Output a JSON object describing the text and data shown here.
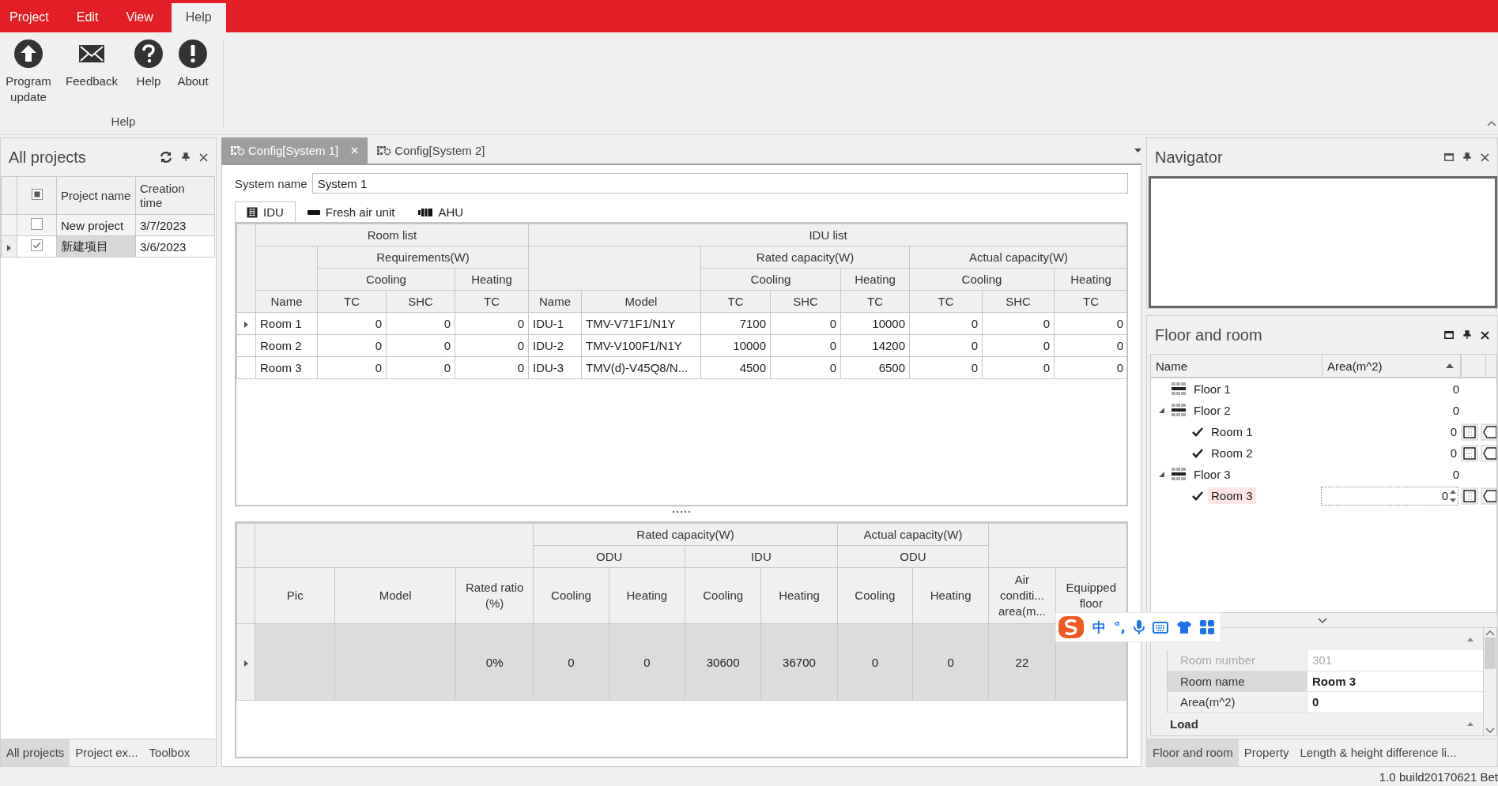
{
  "menu": [
    {
      "label": "Project",
      "selected": false
    },
    {
      "label": "Edit",
      "selected": false
    },
    {
      "label": "View",
      "selected": false
    },
    {
      "label": "Help",
      "selected": true
    }
  ],
  "ribbon": {
    "buttons": [
      "Program update",
      "Feedback",
      "Help",
      "About"
    ],
    "group_label": "Help"
  },
  "projects_panel": {
    "title": "All projects",
    "select_all": {
      "checked": false,
      "partial": true
    },
    "columns": [
      "Project name",
      "Creation time"
    ],
    "rows": [
      {
        "name": "New project",
        "date": "3/7/2023",
        "checked": false,
        "current": false
      },
      {
        "name": "新建项目",
        "date": "3/6/2023",
        "checked": true,
        "current": true
      }
    ],
    "tabs": [
      {
        "label": "All projects",
        "selected": true
      },
      {
        "label": "Project ex...",
        "selected": false
      },
      {
        "label": "Toolbox",
        "selected": false
      }
    ]
  },
  "doc_tabs": [
    {
      "label": "Config[System 1]",
      "selected": true
    },
    {
      "label": "Config[System 2]",
      "selected": false
    }
  ],
  "system_name": {
    "label": "System name",
    "value": "System 1"
  },
  "unit_tabs": [
    {
      "label": "IDU",
      "selected": true
    },
    {
      "label": "Fresh air unit",
      "selected": false
    },
    {
      "label": "AHU",
      "selected": false
    }
  ],
  "idu_table": {
    "header_rows": [
      [
        "Room list",
        "IDU list"
      ],
      [
        "Requirements(W)",
        "Rated capacity(W)",
        "Actual capacity(W)"
      ],
      [
        "Cooling",
        "Heating",
        "Cooling",
        "Heating",
        "Cooling",
        "Heating"
      ],
      [
        "Name",
        "TC",
        "SHC",
        "TC",
        "Name",
        "Model",
        "TC",
        "SHC",
        "TC",
        "TC",
        "SHC",
        "TC"
      ]
    ],
    "rows": [
      {
        "current": true,
        "cells": [
          "Room 1",
          "0",
          "0",
          "0",
          "IDU-1",
          "TMV-V71F1/N1Y",
          "7100",
          "0",
          "10000",
          "0",
          "0",
          "0"
        ]
      },
      {
        "current": false,
        "cells": [
          "Room 2",
          "0",
          "0",
          "0",
          "IDU-2",
          "TMV-V100F1/N1Y",
          "10000",
          "0",
          "14200",
          "0",
          "0",
          "0"
        ]
      },
      {
        "current": false,
        "cells": [
          "Room 3",
          "0",
          "0",
          "0",
          "IDU-3",
          "TMV(d)-V45Q8/N...",
          "4500",
          "0",
          "6500",
          "0",
          "0",
          "0"
        ]
      }
    ]
  },
  "odu_table": {
    "header_rows": [
      [
        "Rated capacity(W)",
        "Actual capacity(W)"
      ],
      [
        "ODU",
        "IDU",
        "ODU"
      ],
      [
        "Pic",
        "Model",
        "Rated ratio (%)",
        "Cooling",
        "Heating",
        "Cooling",
        "Heating",
        "Cooling",
        "Heating",
        "Air conditi... area(m...",
        "Equipped floor"
      ]
    ],
    "rows": [
      {
        "current": true,
        "cells": [
          "0%",
          "0",
          "0",
          "30600",
          "36700",
          "0",
          "0",
          "22"
        ]
      }
    ]
  },
  "navigator": {
    "title": "Navigator"
  },
  "floor_panel": {
    "title": "Floor and room",
    "columns": [
      "Name",
      "Area(m^2)"
    ],
    "tree": [
      {
        "name": "Floor 1",
        "area": "0",
        "selected": false
      },
      {
        "name": "Floor 2",
        "area": "0",
        "selected": false,
        "expanded": true,
        "children": [
          {
            "name": "Room 1",
            "area": "0",
            "checked": true,
            "selected": false
          },
          {
            "name": "Room 2",
            "area": "0",
            "checked": true,
            "selected": false
          }
        ]
      },
      {
        "name": "Floor 3",
        "area": "0",
        "selected": false,
        "expanded": true,
        "children": [
          {
            "name": "Room 3",
            "area": "0",
            "checked": true,
            "selected": true
          }
        ]
      }
    ],
    "properties": [
      {
        "label": "Room number",
        "value": "301",
        "disabled": true,
        "selected": false
      },
      {
        "label": "Room name",
        "value": "Room 3",
        "disabled": false,
        "selected": true
      },
      {
        "label": "Area(m^2)",
        "value": "0",
        "disabled": false,
        "selected": false
      }
    ],
    "category": "Load",
    "tabs": [
      {
        "label": "Floor and room",
        "selected": true
      },
      {
        "label": "Property",
        "selected": false
      },
      {
        "label": "Length & height difference li...",
        "selected": false
      }
    ]
  },
  "ime_toolbar": {
    "mode": "中",
    "punctuation": "°,"
  },
  "status_bar": {
    "version": "1.0 build20170621 Bet"
  }
}
